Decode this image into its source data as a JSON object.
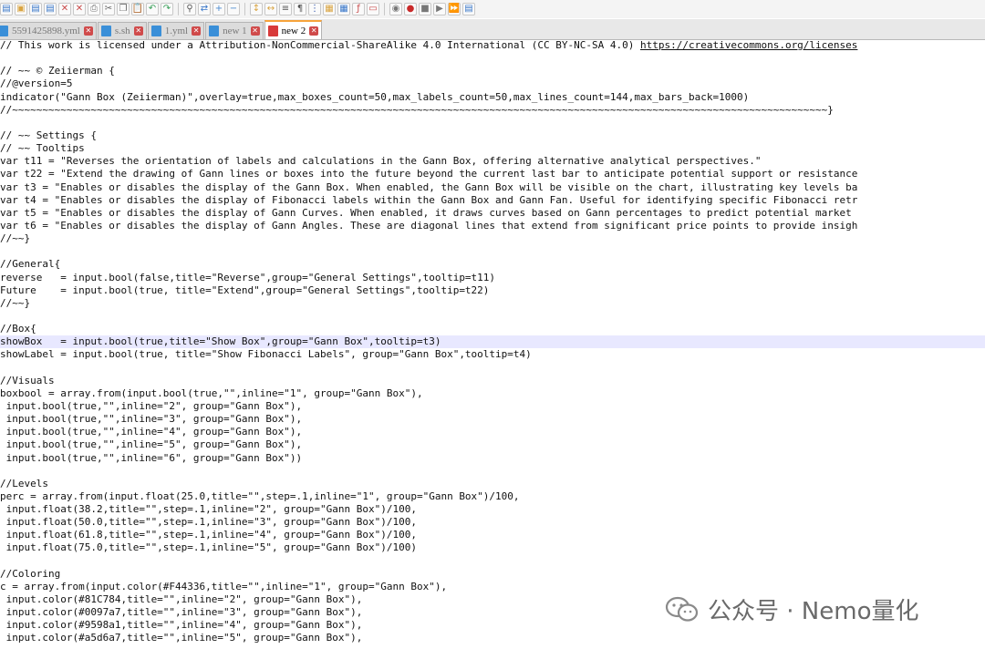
{
  "toolbar": {
    "icons": [
      "new-file",
      "open-file",
      "save",
      "save-all",
      "close",
      "close-all",
      "print",
      "cut",
      "copy",
      "paste",
      "undo",
      "redo",
      "find",
      "replace",
      "zoom-in",
      "zoom-out",
      "sync-vertical",
      "sync-horizontal",
      "word-wrap",
      "show-all-chars",
      "indent-guide",
      "language-user",
      "document-map",
      "function-list",
      "folder-as-workspace",
      "monitoring",
      "macro-record",
      "macro-stop",
      "macro-play",
      "macro-run-multiple",
      "macro-save"
    ]
  },
  "tabs": [
    {
      "label": "5591425898.yml",
      "active": false,
      "icon_color": "#3a8fd8"
    },
    {
      "label": "s.sh",
      "active": false,
      "icon_color": "#3a8fd8"
    },
    {
      "label": "1.yml",
      "active": false,
      "icon_color": "#3a8fd8"
    },
    {
      "label": "new 1",
      "active": false,
      "icon_color": "#3a8fd8"
    },
    {
      "label": "new 2",
      "active": true,
      "icon_color": "#d83a3a"
    }
  ],
  "editor": {
    "current_line_index": 23,
    "lines": [
      "// This work is licensed under a Attribution-NonCommercial-ShareAlike 4.0 International (CC BY-NC-SA 4.0) https://creativecommons.org/licenses",
      "",
      "// ~~ © Zeiierman {",
      "//@version=5",
      "indicator(\"Gann Box (Zeiierman)\",overlay=true,max_boxes_count=50,max_labels_count=50,max_lines_count=144,max_bars_back=1000)",
      "//~~~~~~~~~~~~~~~~~~~~~~~~~~~~~~~~~~~~~~~~~~~~~~~~~~~~~~~~~~~~~~~~~~~~~~~~~~~~~~~~~~~~~~~~~~~~~~~~~~~~~~~~~~~~~~~~~~~~~~~~~~~~~~~~~~~~~~~}",
      "",
      "// ~~ Settings {",
      "// ~~ Tooltips",
      "var t11 = \"Reverses the orientation of labels and calculations in the Gann Box, offering alternative analytical perspectives.\"",
      "var t22 = \"Extend the drawing of Gann lines or boxes into the future beyond the current last bar to anticipate potential support or resistance",
      "var t3 = \"Enables or disables the display of the Gann Box. When enabled, the Gann Box will be visible on the chart, illustrating key levels ba",
      "var t4 = \"Enables or disables the display of Fibonacci labels within the Gann Box and Gann Fan. Useful for identifying specific Fibonacci retr",
      "var t5 = \"Enables or disables the display of Gann Curves. When enabled, it draws curves based on Gann percentages to predict potential market",
      "var t6 = \"Enables or disables the display of Gann Angles. These are diagonal lines that extend from significant price points to provide insigh",
      "//~~}",
      "",
      "//General{",
      "reverse   = input.bool(false,title=\"Reverse\",group=\"General Settings\",tooltip=t11)",
      "Future    = input.bool(true, title=\"Extend\",group=\"General Settings\",tooltip=t22)",
      "//~~}",
      "",
      "//Box{",
      "showBox   = input.bool(true,title=\"Show Box\",group=\"Gann Box\",tooltip=t3)",
      "showLabel = input.bool(true, title=\"Show Fibonacci Labels\", group=\"Gann Box\",tooltip=t4)",
      "",
      "//Visuals",
      "boxbool = array.from(input.bool(true,\"\",inline=\"1\", group=\"Gann Box\"),",
      " input.bool(true,\"\",inline=\"2\", group=\"Gann Box\"),",
      " input.bool(true,\"\",inline=\"3\", group=\"Gann Box\"),",
      " input.bool(true,\"\",inline=\"4\", group=\"Gann Box\"),",
      " input.bool(true,\"\",inline=\"5\", group=\"Gann Box\"),",
      " input.bool(true,\"\",inline=\"6\", group=\"Gann Box\"))",
      "",
      "//Levels",
      "perc = array.from(input.float(25.0,title=\"\",step=.1,inline=\"1\", group=\"Gann Box\")/100,",
      " input.float(38.2,title=\"\",step=.1,inline=\"2\", group=\"Gann Box\")/100,",
      " input.float(50.0,title=\"\",step=.1,inline=\"3\", group=\"Gann Box\")/100,",
      " input.float(61.8,title=\"\",step=.1,inline=\"4\", group=\"Gann Box\")/100,",
      " input.float(75.0,title=\"\",step=.1,inline=\"5\", group=\"Gann Box\")/100)",
      "",
      "//Coloring",
      "c = array.from(input.color(#F44336,title=\"\",inline=\"1\", group=\"Gann Box\"),",
      " input.color(#81C784,title=\"\",inline=\"2\", group=\"Gann Box\"),",
      " input.color(#0097a7,title=\"\",inline=\"3\", group=\"Gann Box\"),",
      " input.color(#9598a1,title=\"\",inline=\"4\", group=\"Gann Box\"),",
      " input.color(#a5d6a7,title=\"\",inline=\"5\", group=\"Gann Box\"),"
    ]
  },
  "watermark": {
    "text": "公众号 · Nemo量化"
  }
}
